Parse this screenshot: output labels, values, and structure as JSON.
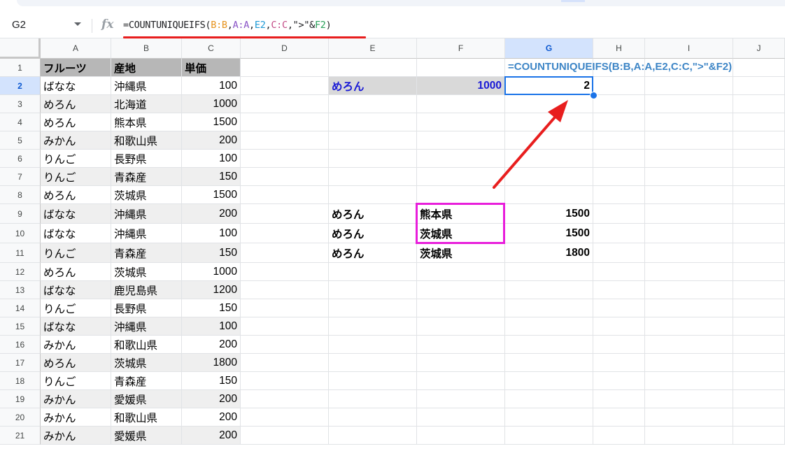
{
  "name_box": "G2",
  "fx_label": "fx",
  "formula_parts": [
    "=COUNTUNIQUEIFS(",
    "B:B",
    ",",
    "A:A",
    ",",
    "E2",
    ",",
    "C:C",
    ",\">\"&",
    "F2",
    ")"
  ],
  "columns": [
    "A",
    "B",
    "C",
    "D",
    "E",
    "F",
    "G",
    "H",
    "I",
    "J"
  ],
  "rows": [
    "1",
    "2",
    "3",
    "4",
    "5",
    "6",
    "7",
    "8",
    "9",
    "10",
    "11",
    "12",
    "13",
    "14",
    "15",
    "16",
    "17",
    "18",
    "19",
    "20",
    "21"
  ],
  "table_headers": {
    "a": "フルーツ",
    "b": "産地",
    "c": "単価"
  },
  "table": [
    [
      "ばなな",
      "沖縄県",
      "100"
    ],
    [
      "めろん",
      "北海道",
      "1000"
    ],
    [
      "めろん",
      "熊本県",
      "1500"
    ],
    [
      "みかん",
      "和歌山県",
      "200"
    ],
    [
      "りんご",
      "長野県",
      "100"
    ],
    [
      "りんご",
      "青森産",
      "150"
    ],
    [
      "めろん",
      "茨城県",
      "1500"
    ],
    [
      "ばなな",
      "沖縄県",
      "200"
    ],
    [
      "ばなな",
      "沖縄県",
      "100"
    ],
    [
      "りんご",
      "青森産",
      "150"
    ],
    [
      "めろん",
      "茨城県",
      "1000"
    ],
    [
      "ばなな",
      "鹿児島県",
      "1200"
    ],
    [
      "りんご",
      "長野県",
      "150"
    ],
    [
      "ばなな",
      "沖縄県",
      "100"
    ],
    [
      "みかん",
      "和歌山県",
      "200"
    ],
    [
      "めろん",
      "茨城県",
      "1800"
    ],
    [
      "りんご",
      "青森産",
      "150"
    ],
    [
      "みかん",
      "愛媛県",
      "200"
    ],
    [
      "みかん",
      "和歌山県",
      "200"
    ],
    [
      "みかん",
      "愛媛県",
      "200"
    ]
  ],
  "formula_display": "=COUNTUNIQUEIFS(B:B,A:A,E2,C:C,\">\"&F2)",
  "criteria": {
    "fruit": "めろん",
    "price": "1000",
    "result": "2"
  },
  "matches": [
    [
      "めろん",
      "熊本県",
      "1500"
    ],
    [
      "めろん",
      "茨城県",
      "1500"
    ],
    [
      "めろん",
      "茨城県",
      "1800"
    ]
  ],
  "colors": {
    "accent_blue": "#1a73e8",
    "red_arrow": "#e81e1e",
    "magenta_box": "#e81edb",
    "header_gray": "#b7b7b7"
  }
}
